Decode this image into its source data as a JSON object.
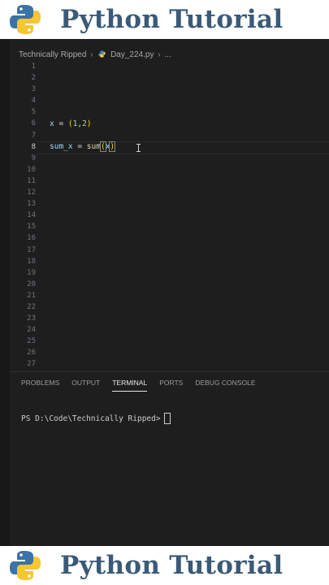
{
  "banner": {
    "title": "Python Tutorial"
  },
  "breadcrumb": {
    "folder": "Technically Ripped",
    "file": "Day_224.py",
    "more": "..."
  },
  "editor": {
    "line_numbers": [
      "1",
      "2",
      "3",
      "4",
      "5",
      "6",
      "7",
      "8",
      "9",
      "10",
      "11",
      "12",
      "13",
      "14",
      "15",
      "16",
      "17",
      "18",
      "19",
      "20",
      "21",
      "22",
      "23",
      "24",
      "25",
      "26",
      "27"
    ],
    "active_line": "8",
    "line6": {
      "var": "x",
      "eq": " = ",
      "open": "(",
      "n1": "1",
      "comma": ",",
      "n2": "2",
      "close": ")"
    },
    "line8": {
      "var": "sum_x",
      "eq": " = ",
      "fn": "sum",
      "open": "(",
      "arg": "x",
      "close": ")"
    }
  },
  "panel": {
    "tabs": [
      "PROBLEMS",
      "OUTPUT",
      "TERMINAL",
      "PORTS",
      "DEBUG CONSOLE"
    ],
    "active_tab": "TERMINAL",
    "prompt": "PS D:\\Code\\Technically Ripped>"
  },
  "colors": {
    "banner_title": "#3a5a78",
    "editor_bg": "#1e1e1e",
    "paren": "#ffd700",
    "keyword_var": "#9cdcfe"
  },
  "icons": {
    "logo": "python-logo-icon",
    "file": "python-file-icon",
    "chevron": "chevron-right-icon",
    "cursor": "text-cursor-icon"
  }
}
